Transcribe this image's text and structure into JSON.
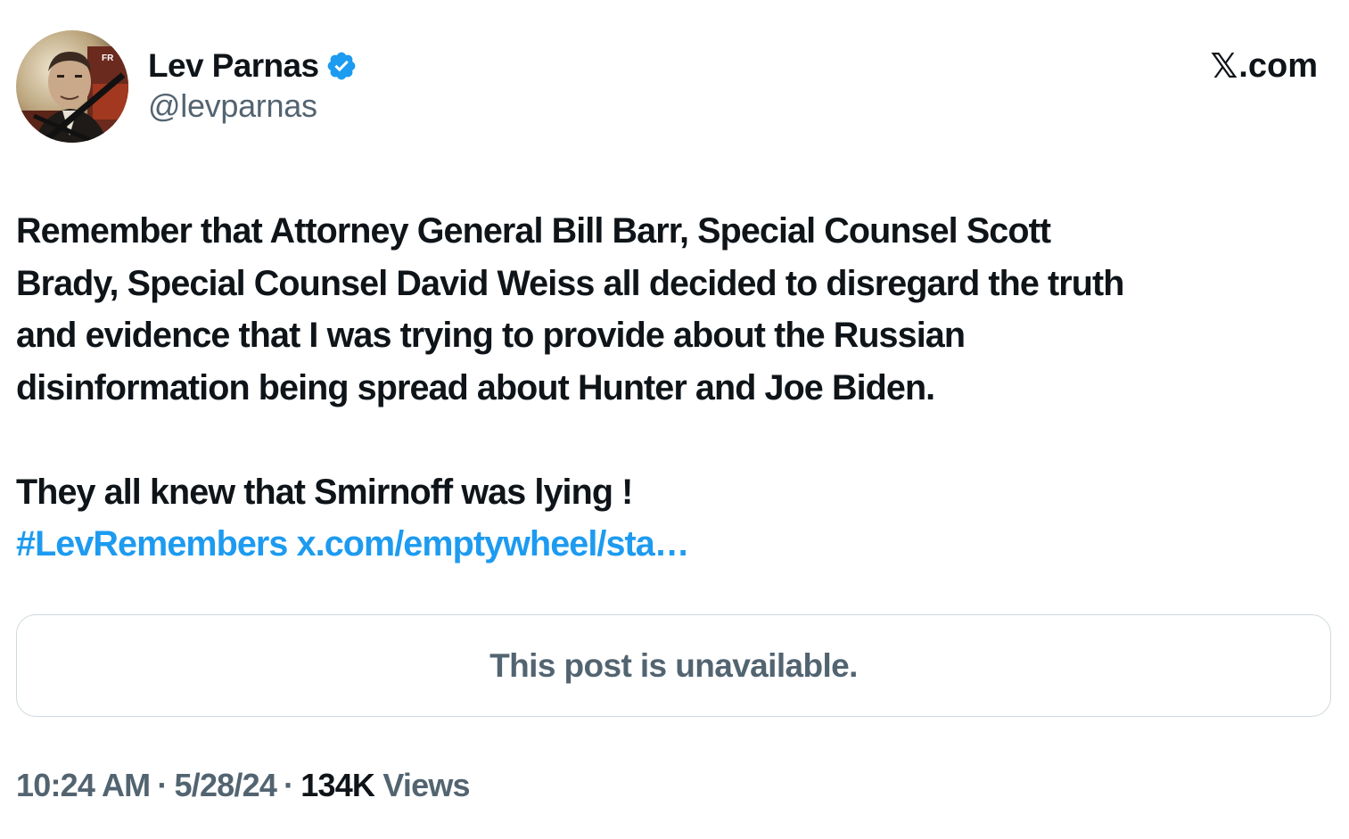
{
  "author": {
    "display_name": "Lev Parnas",
    "handle": "@levparnas",
    "verified": true,
    "verified_color": "#1d9bf0",
    "avatar_icon": "profile-photo"
  },
  "brand": {
    "label": ".com",
    "logo_icon": "x-logo-icon"
  },
  "tweet": {
    "paragraph_1": [
      "Remember that Attorney General Bill Barr, Special Counsel Scott",
      "Brady, Special Counsel David Weiss all decided to disregard the truth",
      "and evidence that I was trying to provide about the Russian",
      "disinformation being spread about Hunter and Joe Biden."
    ],
    "paragraph_2": "They all knew that Smirnoff was lying !",
    "hashtag": "#LevRemembers",
    "link": "x.com/emptywheel/sta…",
    "link_color": "#1d9bf0"
  },
  "quoted_post": {
    "message": "This post is unavailable."
  },
  "meta": {
    "time": "10:24 AM",
    "separator": "·",
    "date": "5/28/24",
    "views_count": "134K",
    "views_label": "Views"
  }
}
